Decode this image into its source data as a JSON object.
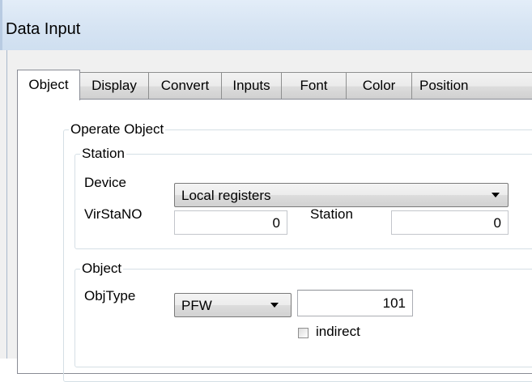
{
  "window": {
    "title": "Data Input"
  },
  "tabs": [
    {
      "label": "Object",
      "active": true
    },
    {
      "label": "Display",
      "active": false
    },
    {
      "label": "Convert",
      "active": false
    },
    {
      "label": "Inputs",
      "active": false
    },
    {
      "label": "Font",
      "active": false
    },
    {
      "label": "Color",
      "active": false
    },
    {
      "label": "Position",
      "active": false
    }
  ],
  "operate_object": {
    "legend": "Operate Object",
    "station": {
      "legend": "Station",
      "device_label": "Device",
      "device_value": "Local registers",
      "virstano_label": "VirStaNO",
      "virstano_value": "0",
      "station_label": "Station",
      "station_value": "0"
    },
    "object": {
      "legend": "Object",
      "objtype_label": "ObjType",
      "objtype_value": "PFW",
      "address_value": "101",
      "indirect_label": "indirect",
      "indirect_checked": false
    }
  },
  "colors": {
    "title_bar": "#d6e4f3",
    "client_bg": "#f0f0f0",
    "frame_border": "#d5dfe5"
  }
}
